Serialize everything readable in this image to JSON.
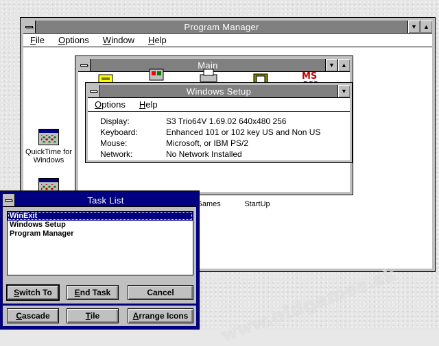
{
  "program_manager": {
    "title": "Program Manager",
    "menu": [
      "File",
      "Options",
      "Window",
      "Help"
    ],
    "groups": [
      {
        "label": "QuickTime for Windows"
      },
      {
        "label": "Games"
      },
      {
        "label": "StartUp"
      }
    ]
  },
  "main_window": {
    "title": "Main"
  },
  "windows_setup": {
    "title": "Windows Setup",
    "menu": [
      "Options",
      "Help"
    ],
    "rows": [
      {
        "label": "Display:",
        "value": "S3 Trio64V 1.69.02  640x480  256"
      },
      {
        "label": "Keyboard:",
        "value": "Enhanced 101 or 102 key US and Non US"
      },
      {
        "label": "Mouse:",
        "value": "Microsoft, or IBM PS/2"
      },
      {
        "label": "Network:",
        "value": "No Network Installed"
      }
    ]
  },
  "task_list": {
    "title": "Task List",
    "items": [
      "WinExit",
      "Windows Setup",
      "Program Manager"
    ],
    "selected_index": 0,
    "buttons": {
      "switch_to": "Switch To",
      "end_task": "End Task",
      "cancel": "Cancel",
      "cascade": "Cascade",
      "tile": "Tile",
      "arrange_icons": "Arrange Icons"
    }
  },
  "watermark": "www.oldgames.sk",
  "colors": {
    "active_title": "#000080",
    "inactive_title": "#808080",
    "face": "#c0c0c0"
  }
}
